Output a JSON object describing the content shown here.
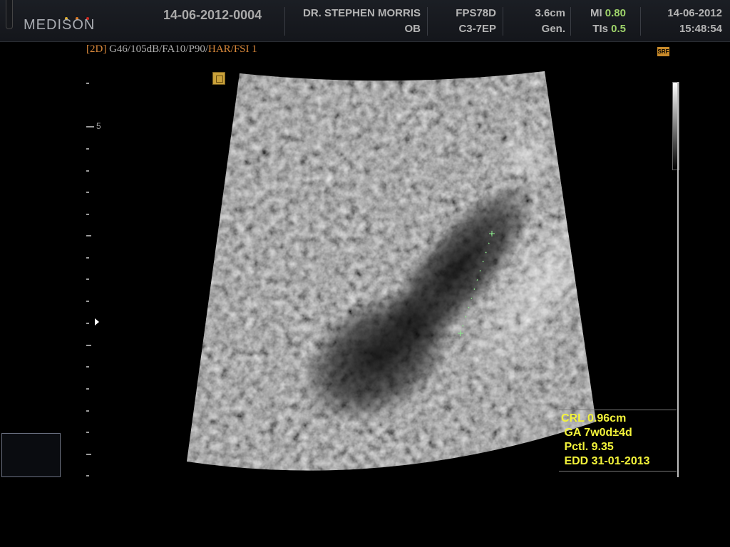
{
  "header": {
    "logo": "MEDISON",
    "patient_id": "14-06-2012-0004",
    "doctor": "DR. STEPHEN MORRIS",
    "exam_type": "OB",
    "frame_rate": "FPS78D",
    "probe": "C3-7EP",
    "depth": "3.6cm",
    "preset": "Gen.",
    "mi_label": "MI",
    "mi_value": "0.80",
    "tis_label": "TIs",
    "tis_value": "0.5",
    "date": "14-06-2012",
    "time": "15:48:54"
  },
  "imaging_params": {
    "mode": "[2D]",
    "settings": " G46/105dB/FA10/P90/",
    "harmonic": "HAR",
    "filter": "/FSI 1"
  },
  "srf_icon_label": "SRF",
  "depth_scale": {
    "mark_label": "5"
  },
  "measurement": {
    "crl": "CRL 0.96cm",
    "ga": " GA 7w0d±4d",
    "pctl": " Pctl. 9.35",
    "edd": " EDD 31-01-2013"
  },
  "colors": {
    "background": "#000000",
    "header": "#1b1e24",
    "measurement_text": "#f3f33a",
    "param_accent": "#d9883a",
    "caliper": "#8ef08e"
  }
}
